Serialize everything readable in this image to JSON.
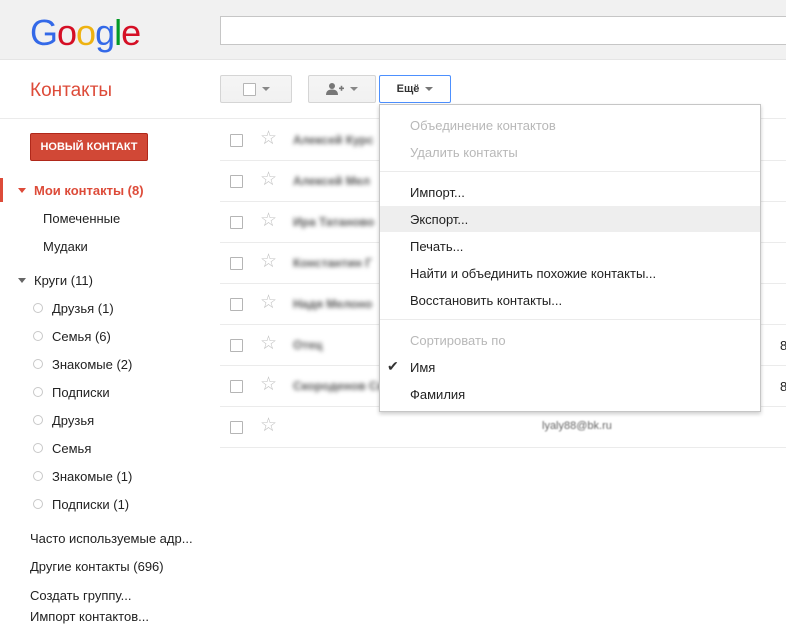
{
  "logo": {
    "letters": [
      "G",
      "o",
      "o",
      "g",
      "l",
      "e"
    ],
    "colors": [
      "#3369e8",
      "#d50f25",
      "#eeb211",
      "#3369e8",
      "#009925",
      "#d50f25"
    ]
  },
  "search": {
    "placeholder": "",
    "value": ""
  },
  "app_title": "Контакты",
  "toolbar": {
    "more_label": "Ещё",
    "add_user_icon": "add-person-icon"
  },
  "new_contact_label": "НОВЫЙ КОНТАКТ",
  "accent_color": "#dd4b39",
  "sidebar": {
    "my_contacts": "Мои контакты (8)",
    "starred": "Помеченные",
    "custom_group": "Мудаки",
    "circles": "Круги (11)",
    "circle_items": [
      "Друзья (1)",
      "Семья (6)",
      "Знакомые (2)",
      "Подписки",
      "Друзья",
      "Семья",
      "Знакомые (1)",
      "Подписки (1)"
    ],
    "frequent": "Часто используемые адр...",
    "other_contacts": "Другие контакты (696)",
    "create_group": "Создать группу...",
    "import_contacts": "Импорт контактов..."
  },
  "contacts": [
    {
      "name": "Алексей Курс",
      "email": "",
      "num": ""
    },
    {
      "name": "Алексей Мел",
      "email": "",
      "num": ""
    },
    {
      "name": "Ира Татаново",
      "email": "",
      "num": ""
    },
    {
      "name": "Константин Г",
      "email": "",
      "num": ""
    },
    {
      "name": "Надя Мелоно",
      "email": "",
      "num": ""
    },
    {
      "name": "Отец",
      "email": "",
      "num": "8"
    },
    {
      "name": "Скороденов Се",
      "email": "",
      "num": "8"
    },
    {
      "name": "",
      "email": "lyaly88@bk.ru",
      "num": ""
    }
  ],
  "menu": {
    "merge": "Объединение контактов",
    "delete": "Удалить контакты",
    "import": "Импорт...",
    "export": "Экспорт...",
    "print": "Печать...",
    "find_merge": "Найти и объединить похожие контакты...",
    "restore": "Восстановить контакты...",
    "sort_by": "Сортировать по",
    "sort_first": "Имя",
    "sort_last": "Фамилия"
  }
}
